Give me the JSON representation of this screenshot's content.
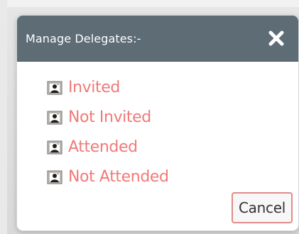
{
  "dialog": {
    "title": "Manage Delegates:-",
    "close_icon": "close-icon",
    "options": [
      {
        "label": "Invited",
        "icon": "person-picture-icon"
      },
      {
        "label": "Not Invited",
        "icon": "person-picture-icon"
      },
      {
        "label": "Attended",
        "icon": "person-picture-icon"
      },
      {
        "label": "Not Attended",
        "icon": "person-picture-icon"
      }
    ],
    "cancel_label": "Cancel"
  },
  "colors": {
    "header_bg": "#5d6c75",
    "link_text": "#f07a78",
    "cancel_border": "#e08b8a"
  }
}
